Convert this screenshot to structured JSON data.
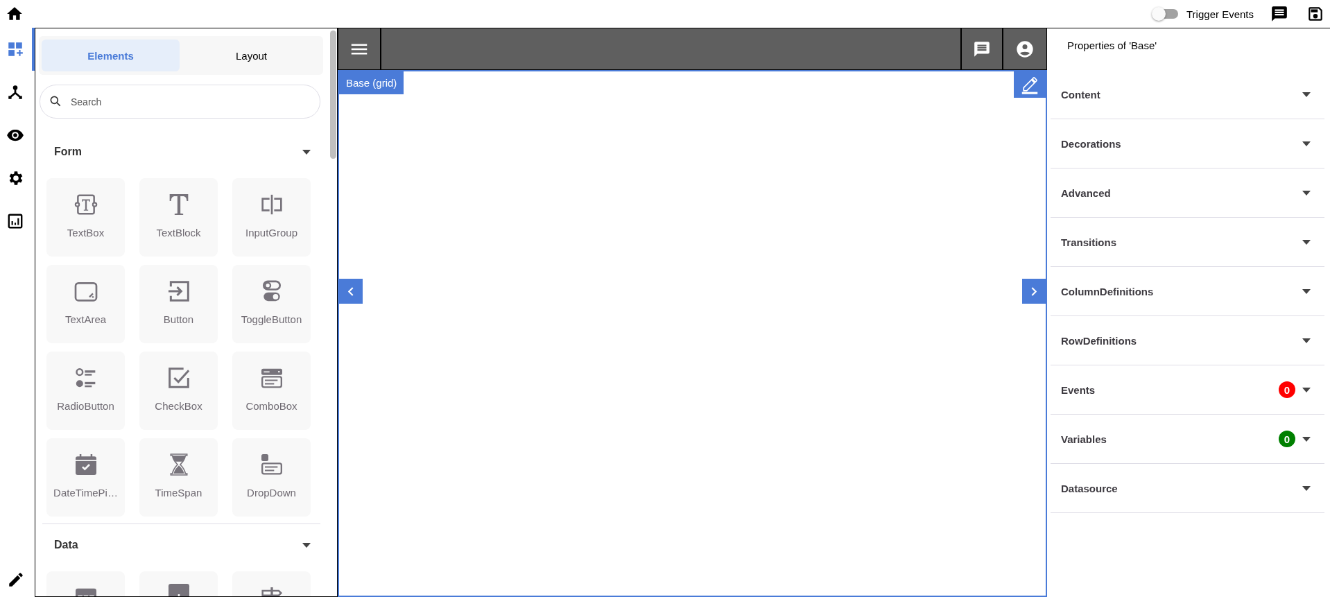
{
  "top_bar": {
    "trigger_events": {
      "label": "Trigger Events",
      "on": false
    }
  },
  "rail": [
    {
      "kind": "dashboard",
      "selected": true
    },
    {
      "kind": "fork",
      "selected": false
    },
    {
      "kind": "eye",
      "selected": false
    },
    {
      "kind": "gear",
      "selected": false
    },
    {
      "kind": "chart",
      "selected": false
    }
  ],
  "palette": {
    "tabs": [
      {
        "label": "Elements",
        "selected": true
      },
      {
        "label": "Layout",
        "selected": false
      }
    ],
    "search": {
      "placeholder": "Search"
    },
    "groups": [
      {
        "title": "Form",
        "expanded": true,
        "items": [
          {
            "kind": "textbox",
            "label": "TextBox"
          },
          {
            "kind": "textblock",
            "label": "TextBlock"
          },
          {
            "kind": "inputgroup",
            "label": "InputGroup"
          },
          {
            "kind": "textarea",
            "label": "TextArea"
          },
          {
            "kind": "button",
            "label": "Button"
          },
          {
            "kind": "toggle",
            "label": "ToggleButton"
          },
          {
            "kind": "radio",
            "label": "RadioButton"
          },
          {
            "kind": "checkbox",
            "label": "CheckBox"
          },
          {
            "kind": "combobox",
            "label": "ComboBox"
          },
          {
            "kind": "calendar",
            "label": "DateTimePi…"
          },
          {
            "kind": "hourglass",
            "label": "TimeSpan"
          },
          {
            "kind": "dropdown",
            "label": "DropDown"
          }
        ]
      },
      {
        "title": "Data",
        "expanded": true,
        "items": [
          {
            "kind": "table"
          },
          {
            "kind": "barchart"
          },
          {
            "kind": "signpost"
          }
        ]
      }
    ]
  },
  "canvas": {
    "label": "Base (grid)"
  },
  "properties": {
    "title": "Properties of 'Base'",
    "sections": [
      {
        "label": "Content"
      },
      {
        "label": "Decorations"
      },
      {
        "label": "Advanced"
      },
      {
        "label": "Transitions"
      },
      {
        "label": "ColumnDefinitions"
      },
      {
        "label": "RowDefinitions"
      },
      {
        "label": "Events",
        "badge": "0",
        "color": "#ff0000"
      },
      {
        "label": "Variables",
        "badge": "0",
        "color": "#008000"
      },
      {
        "label": "Datasource"
      }
    ]
  }
}
